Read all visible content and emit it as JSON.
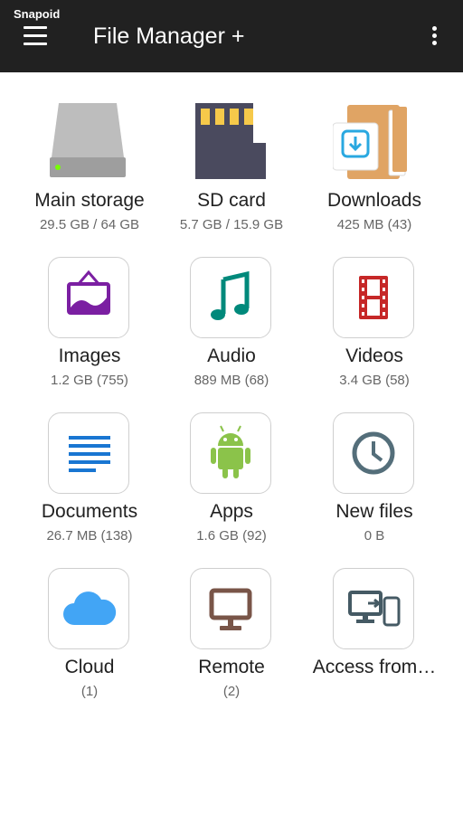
{
  "status": {
    "app_badge": "Snapoid"
  },
  "toolbar": {
    "title": "File Manager +"
  },
  "tiles": [
    {
      "label": "Main storage",
      "sub": "29.5 GB / 64 GB",
      "icon": "hard-drive-icon"
    },
    {
      "label": "SD card",
      "sub": "5.7 GB / 15.9 GB",
      "icon": "sd-card-icon"
    },
    {
      "label": "Downloads",
      "sub": "425 MB (43)",
      "icon": "downloads-folder-icon"
    },
    {
      "label": "Images",
      "sub": "1.2 GB (755)",
      "icon": "image-icon"
    },
    {
      "label": "Audio",
      "sub": "889 MB (68)",
      "icon": "music-note-icon"
    },
    {
      "label": "Videos",
      "sub": "3.4 GB (58)",
      "icon": "film-icon"
    },
    {
      "label": "Documents",
      "sub": "26.7 MB (138)",
      "icon": "document-icon"
    },
    {
      "label": "Apps",
      "sub": "1.6 GB (92)",
      "icon": "android-icon"
    },
    {
      "label": "New files",
      "sub": "0 B",
      "icon": "clock-icon"
    },
    {
      "label": "Cloud",
      "sub": "(1)",
      "icon": "cloud-icon"
    },
    {
      "label": "Remote",
      "sub": "(2)",
      "icon": "monitor-icon"
    },
    {
      "label": "Access from…",
      "sub": "",
      "icon": "devices-icon"
    }
  ],
  "colors": {
    "topbar": "#212121",
    "images": "#7b1fa2",
    "audio": "#00897b",
    "videos": "#c62828",
    "documents": "#1976d2",
    "apps": "#8bc34a",
    "new_files": "#546e7a",
    "cloud": "#42a5f5",
    "remote": "#795548",
    "access": "#455a64"
  }
}
